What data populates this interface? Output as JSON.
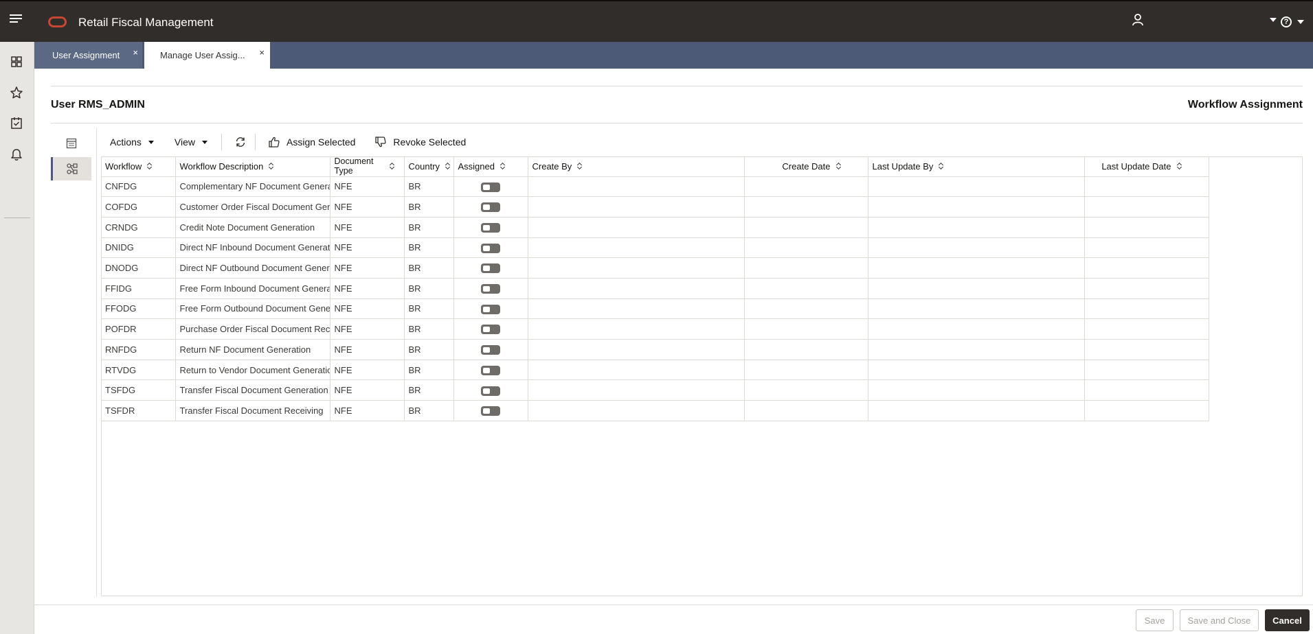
{
  "app": {
    "title": "Retail Fiscal Management",
    "user_name": ""
  },
  "tabs": [
    {
      "label": "User Assignment",
      "close": "×"
    },
    {
      "label": "Manage User Assig...",
      "close": "×"
    }
  ],
  "page": {
    "user_title": "User RMS_ADMIN",
    "section_title": "Workflow Assignment"
  },
  "toolbar": {
    "actions_label": "Actions",
    "view_label": "View",
    "assign_label": "Assign Selected",
    "revoke_label": "Revoke Selected"
  },
  "table": {
    "columns": [
      "Workflow",
      "Workflow Description",
      "Document Type",
      "Country",
      "Assigned",
      "Create By",
      "Create Date",
      "Last Update By",
      "Last Update Date"
    ],
    "rows": [
      {
        "workflow": "CNFDG",
        "description": "Complementary NF Document Genera",
        "doc_type": "NFE",
        "country": "BR",
        "assigned": false
      },
      {
        "workflow": "COFDG",
        "description": "Customer Order Fiscal Document Gene",
        "doc_type": "NFE",
        "country": "BR",
        "assigned": false
      },
      {
        "workflow": "CRNDG",
        "description": "Credit Note Document Generation",
        "doc_type": "NFE",
        "country": "BR",
        "assigned": false
      },
      {
        "workflow": "DNIDG",
        "description": "Direct NF Inbound Document Generati",
        "doc_type": "NFE",
        "country": "BR",
        "assigned": false
      },
      {
        "workflow": "DNODG",
        "description": "Direct NF Outbound Document Genera",
        "doc_type": "NFE",
        "country": "BR",
        "assigned": false
      },
      {
        "workflow": "FFIDG",
        "description": "Free Form Inbound Document Generat",
        "doc_type": "NFE",
        "country": "BR",
        "assigned": false
      },
      {
        "workflow": "FFODG",
        "description": "Free Form Outbound Document Gener",
        "doc_type": "NFE",
        "country": "BR",
        "assigned": false
      },
      {
        "workflow": "POFDR",
        "description": "Purchase Order Fiscal Document Recei",
        "doc_type": "NFE",
        "country": "BR",
        "assigned": false
      },
      {
        "workflow": "RNFDG",
        "description": "Return NF Document Generation",
        "doc_type": "NFE",
        "country": "BR",
        "assigned": false
      },
      {
        "workflow": "RTVDG",
        "description": "Return to Vendor Document Generatio",
        "doc_type": "NFE",
        "country": "BR",
        "assigned": false
      },
      {
        "workflow": "TSFDG",
        "description": "Transfer Fiscal Document Generation",
        "doc_type": "NFE",
        "country": "BR",
        "assigned": false
      },
      {
        "workflow": "TSFDR",
        "description": "Transfer Fiscal Document Receiving",
        "doc_type": "NFE",
        "country": "BR",
        "assigned": false
      }
    ]
  },
  "footer": {
    "save_label": "Save",
    "save_close_label": "Save and Close",
    "cancel_label": "Cancel"
  },
  "colors": {
    "topbar": "#312d2a",
    "tabstrip": "#4c5a77",
    "brand": "#c74634",
    "toggle_off": "#6f6b67"
  }
}
